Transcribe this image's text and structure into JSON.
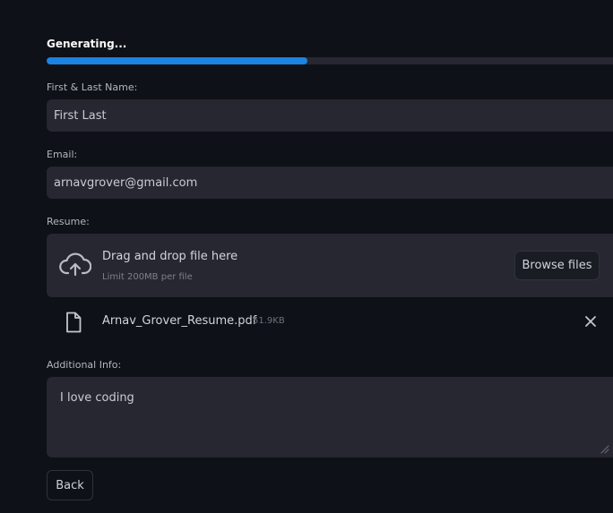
{
  "progress": {
    "label": "Generating...",
    "value": 0.455,
    "fill_color": "#1c83e1"
  },
  "form": {
    "name": {
      "label": "First & Last Name:",
      "value": "First Last"
    },
    "email": {
      "label": "Email:",
      "value": "arnavgrover@gmail.com"
    },
    "resume": {
      "label": "Resume:",
      "dropzone_title": "Drag and drop file here",
      "dropzone_limit": "Limit 200MB per file",
      "browse_label": "Browse files",
      "upload_icon": "cloud-upload-icon",
      "file": {
        "name": "Arnav_Grover_Resume.pdf",
        "size": "51.9KB",
        "icon": "file-icon",
        "remove_icon": "close-icon"
      }
    },
    "additional": {
      "label": "Additional Info:",
      "value": "I love coding"
    },
    "back_label": "Back"
  }
}
